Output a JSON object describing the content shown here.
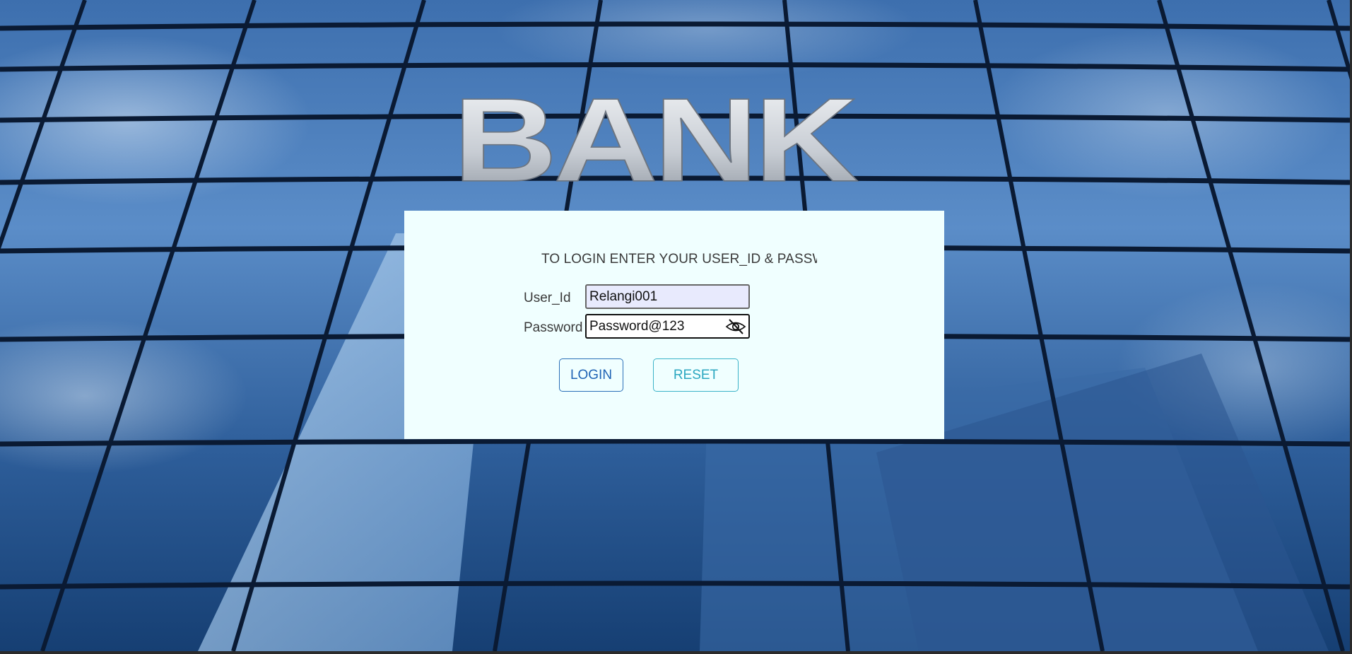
{
  "background": {
    "sign_text": "BANK"
  },
  "login_form": {
    "title": "TO LOGIN ENTER YOUR USER_ID & PASSWORD",
    "user_id_label": "User_Id",
    "user_id_value": "Relangi001",
    "password_label": "Password",
    "password_value": "Password@123",
    "toggle_icon": "eye-slash-icon",
    "login_button": "LOGIN",
    "reset_button": "RESET"
  },
  "colors": {
    "card_bg": "#f0ffff",
    "login_accent": "#1f63b5",
    "reset_accent": "#2aa7c0",
    "sky_blue": "#1d4d8a"
  }
}
